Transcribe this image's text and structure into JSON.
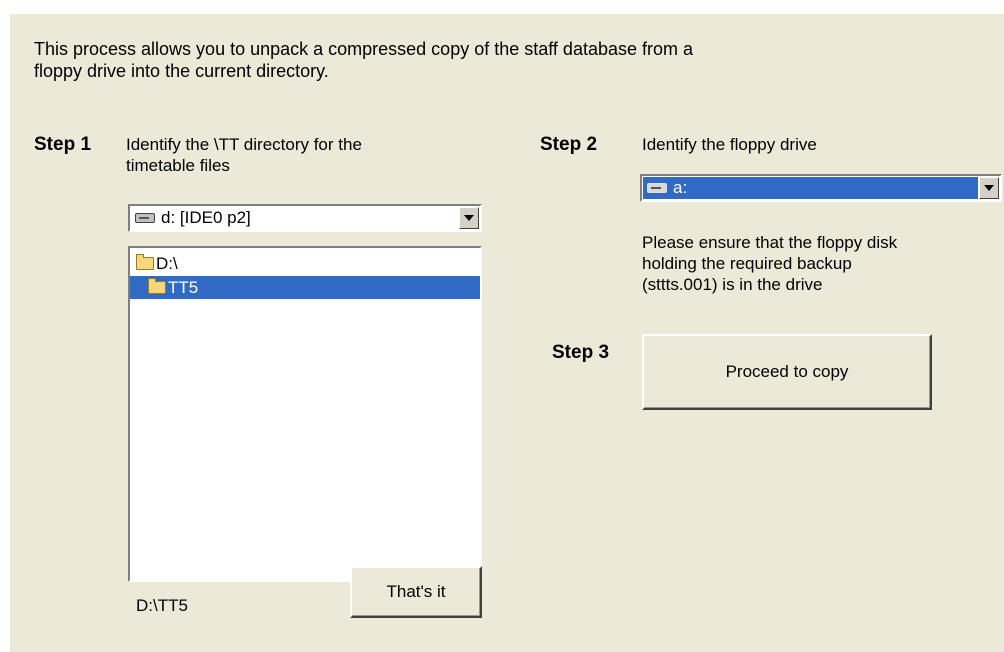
{
  "intro": {
    "line1": "This process allows you to unpack a compressed copy of the staff database from a",
    "line2": "floppy drive into the current directory."
  },
  "step1": {
    "label": "Step 1",
    "text_line1": "Identify the \\TT directory for the",
    "text_line2": "timetable files",
    "drive_combo": {
      "value": "d: [IDE0 p2]",
      "icon": "hard-drive-icon"
    },
    "directories": [
      {
        "label": "D:\\",
        "icon": "open-folder-icon",
        "selected": false
      },
      {
        "label": "TT5",
        "icon": "open-folder-icon",
        "selected": true
      }
    ],
    "current_path": "D:\\TT5",
    "confirm_label": "That's it"
  },
  "step2": {
    "label": "Step 2",
    "text": "Identify the floppy drive",
    "floppy_combo": {
      "value": "a:",
      "icon": "floppy-drive-icon"
    },
    "note_line1": "Please ensure that the floppy disk",
    "note_line2": "holding the required backup",
    "note_line3": "(sttts.001) is in the drive"
  },
  "step3": {
    "label": "Step 3",
    "button_label": "Proceed to copy"
  },
  "colors": {
    "panel": "#ece9d8",
    "selection": "#316ac5"
  }
}
